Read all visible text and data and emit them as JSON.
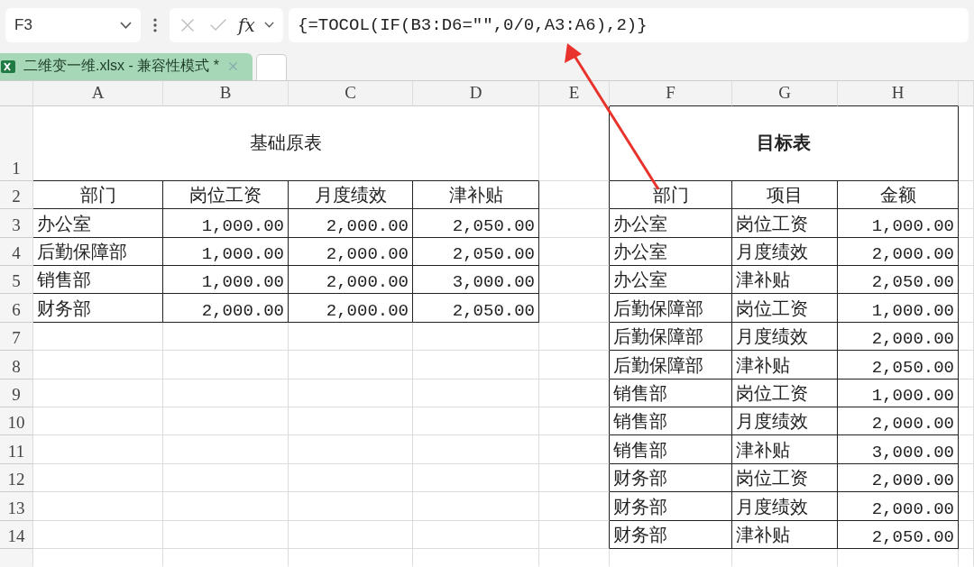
{
  "formula_bar": {
    "name_box": "F3",
    "function_label": "fx",
    "formula": "{=TOCOL(IF(B3:D6=\"\",0/0,A3:A6),2)}"
  },
  "file_tab": {
    "title": "二维变一维.xlsx  -  兼容性模式 *",
    "selected": true
  },
  "columns": [
    "A",
    "B",
    "C",
    "D",
    "E",
    "F",
    "G",
    "H"
  ],
  "rows": [
    "1",
    "2",
    "3",
    "4",
    "5",
    "6",
    "7",
    "8",
    "9",
    "10",
    "11",
    "12",
    "13",
    "14"
  ],
  "source_table": {
    "title": "基础原表",
    "header": [
      "部门",
      "岗位工资",
      "月度绩效",
      "津补贴"
    ],
    "rows": [
      [
        "办公室",
        "1,000.00",
        "2,000.00",
        "2,050.00"
      ],
      [
        "后勤保障部",
        "1,000.00",
        "2,000.00",
        "2,050.00"
      ],
      [
        "销售部",
        "1,000.00",
        "2,000.00",
        "3,000.00"
      ],
      [
        "财务部",
        "2,000.00",
        "2,000.00",
        "2,050.00"
      ]
    ]
  },
  "target_table": {
    "title": "目标表",
    "header": [
      "部门",
      "项目",
      "金额"
    ],
    "rows": [
      [
        "办公室",
        "岗位工资",
        "1,000.00"
      ],
      [
        "办公室",
        "月度绩效",
        "2,000.00"
      ],
      [
        "办公室",
        "津补贴",
        "2,050.00"
      ],
      [
        "后勤保障部",
        "岗位工资",
        "1,000.00"
      ],
      [
        "后勤保障部",
        "月度绩效",
        "2,000.00"
      ],
      [
        "后勤保障部",
        "津补贴",
        "2,050.00"
      ],
      [
        "销售部",
        "岗位工资",
        "1,000.00"
      ],
      [
        "销售部",
        "月度绩效",
        "2,000.00"
      ],
      [
        "销售部",
        "津补贴",
        "3,000.00"
      ],
      [
        "财务部",
        "岗位工资",
        "2,000.00"
      ],
      [
        "财务部",
        "月度绩效",
        "2,000.00"
      ],
      [
        "财务部",
        "津补贴",
        "2,050.00"
      ]
    ]
  }
}
